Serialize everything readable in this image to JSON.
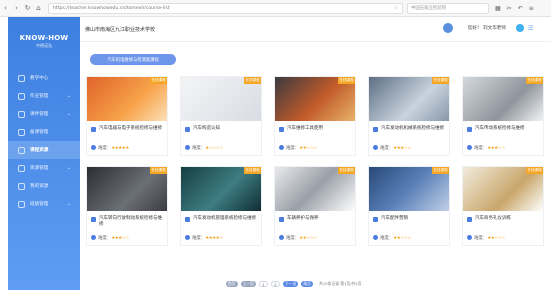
{
  "browser": {
    "url": "https://teacher.knowhowedu.cn/tomexh/course-list",
    "search_placeholder": "中国石家庄检验院",
    "nav": [
      "‹",
      "›",
      "↻",
      "⌂"
    ]
  },
  "sidebar": {
    "logo": "KNOW-HOW",
    "logo_sub": "中德诺浩",
    "items": [
      {
        "label": "教学中心",
        "active": false
      },
      {
        "label": "作业管理",
        "active": false
      },
      {
        "label": "课件管理",
        "active": false
      },
      {
        "label": "备课管理",
        "active": false
      },
      {
        "label": "课程资源",
        "active": true
      },
      {
        "label": "资源管理",
        "active": false
      },
      {
        "label": "我的资源",
        "active": false
      },
      {
        "label": "班级管理",
        "active": false
      }
    ]
  },
  "header": {
    "school": "佛山市南海区九江职业技术学校",
    "user": "您好！ 刘文华老师"
  },
  "filter": {
    "label": "汽车机电维修与检测类课程"
  },
  "courses": [
    {
      "title": "汽车电器与电子系统检修与维修",
      "rating_label": "难度：",
      "stars": "★★★★★",
      "tag": "在线课程",
      "theme": "orange"
    },
    {
      "title": "汽车构造认知",
      "rating_label": "难度：",
      "stars": "★☆☆☆☆",
      "tag": "在线课程",
      "theme": "light"
    },
    {
      "title": "汽车维修工具使用",
      "rating_label": "难度：",
      "stars": "★★☆☆☆",
      "tag": "在线课程",
      "theme": "tools"
    },
    {
      "title": "汽车发动机机械系统检修与维修",
      "rating_label": "难度：",
      "stars": "★★★☆☆",
      "tag": "在线课程",
      "theme": "engine"
    },
    {
      "title": "汽车传动系统检修与维修",
      "rating_label": "难度：",
      "stars": "★★★☆☆",
      "tag": "在线课程",
      "theme": "silver"
    },
    {
      "title": "汽车转向行驶制动系统检修与维修",
      "rating_label": "难度：",
      "stars": "★★★☆☆",
      "tag": "在线课程",
      "theme": "dark"
    },
    {
      "title": "汽车发动机管理系统检修与维修",
      "rating_label": "难度：",
      "stars": "★★★★☆",
      "tag": "在线课程",
      "theme": "teal"
    },
    {
      "title": "车辆养护与保养",
      "rating_label": "难度：",
      "stars": "★★☆☆☆",
      "tag": "在线课程",
      "theme": "cars"
    },
    {
      "title": "汽车配件营销",
      "rating_label": "难度：",
      "stars": "★★☆☆☆",
      "tag": "在线课程",
      "theme": "parts"
    },
    {
      "title": "汽车商务礼仪训练",
      "rating_label": "难度：",
      "stars": "★★☆☆☆",
      "tag": "在线课程",
      "theme": "etiquette"
    }
  ],
  "pager": {
    "first": "首页",
    "prev": "上一页",
    "p1": "1",
    "p2": "2",
    "next": "下一页",
    "last": "尾页",
    "info": "共10条记录 第1页/共2页"
  },
  "colors": {
    "sidebar_top": "#3d7fe0",
    "sidebar_bottom": "#5e9df3",
    "accent": "#5b89e6",
    "tag": "#f5a623",
    "star": "#f2a012"
  }
}
